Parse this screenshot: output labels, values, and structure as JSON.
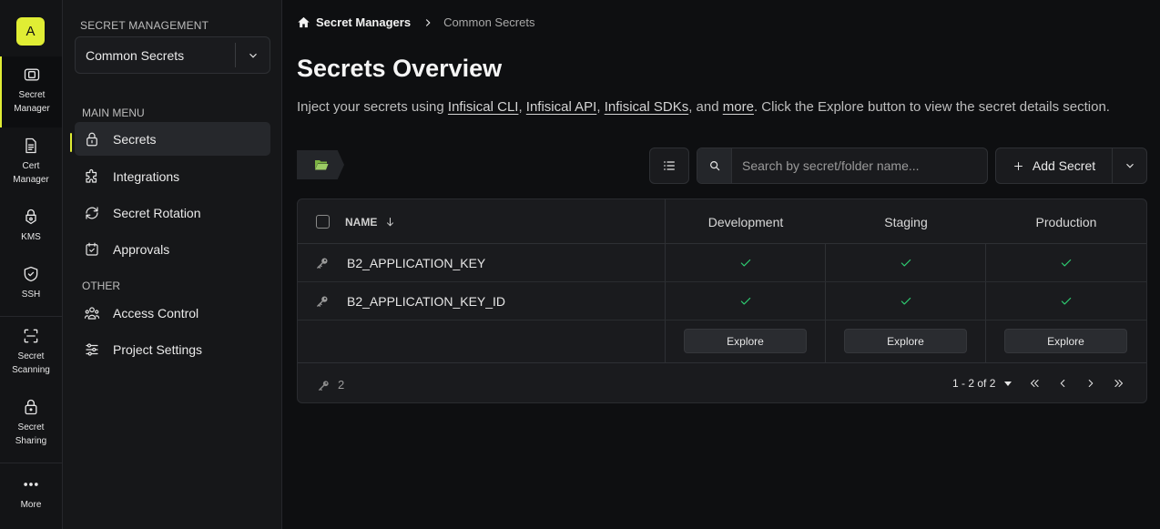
{
  "rail": {
    "avatar_letter": "A",
    "items": [
      {
        "label_line1": "Secret",
        "label_line2": "Manager",
        "icon": "secret-manager-icon"
      },
      {
        "label_line1": "Cert",
        "label_line2": "Manager",
        "icon": "certificate-icon"
      },
      {
        "label_line1": "KMS",
        "label_line2": "",
        "icon": "kms-lock-icon"
      },
      {
        "label_line1": "SSH",
        "label_line2": "",
        "icon": "shield-icon"
      },
      {
        "label_line1": "Secret",
        "label_line2": "Scanning",
        "icon": "scan-icon"
      },
      {
        "label_line1": "Secret",
        "label_line2": "Sharing",
        "icon": "lock-icon"
      },
      {
        "label_line1": "More",
        "label_line2": "",
        "icon": "more-dots-icon"
      }
    ]
  },
  "sidebar": {
    "heading": "SECRET MANAGEMENT",
    "project_select": "Common Secrets",
    "main_menu_label": "MAIN MENU",
    "main_items": [
      {
        "label": "Secrets",
        "icon": "lock-icon"
      },
      {
        "label": "Integrations",
        "icon": "puzzle-icon"
      },
      {
        "label": "Secret Rotation",
        "icon": "rotate-icon"
      },
      {
        "label": "Approvals",
        "icon": "approvals-icon"
      }
    ],
    "other_label": "OTHER",
    "other_items": [
      {
        "label": "Access Control",
        "icon": "users-icon"
      },
      {
        "label": "Project Settings",
        "icon": "settings-sliders-icon"
      }
    ]
  },
  "breadcrumb": {
    "root": "Secret Managers",
    "current": "Common Secrets"
  },
  "page": {
    "title": "Secrets Overview",
    "desc_prefix": "Inject your secrets using ",
    "link_cli": "Infisical CLI",
    "comma1": ", ",
    "link_api": "Infisical API",
    "comma2": ", ",
    "link_sdks": "Infisical SDKs",
    "and": ", and ",
    "link_more": "more",
    "desc_suffix": ". Click the Explore button to view the secret details section."
  },
  "toolbar": {
    "search_placeholder": "Search by secret/folder name...",
    "add_label": "Add Secret"
  },
  "table": {
    "name_header": "NAME",
    "environments": [
      "Development",
      "Staging",
      "Production"
    ],
    "rows": [
      {
        "name": "B2_APPLICATION_KEY",
        "present": [
          true,
          true,
          true
        ]
      },
      {
        "name": "B2_APPLICATION_KEY_ID",
        "present": [
          true,
          true,
          true
        ]
      }
    ],
    "explore_label": "Explore",
    "count": "2",
    "pagination": "1 - 2 of 2"
  },
  "colors": {
    "accent": "#e0ed34",
    "check": "#2ecc71",
    "folder": "#8bc34a"
  }
}
